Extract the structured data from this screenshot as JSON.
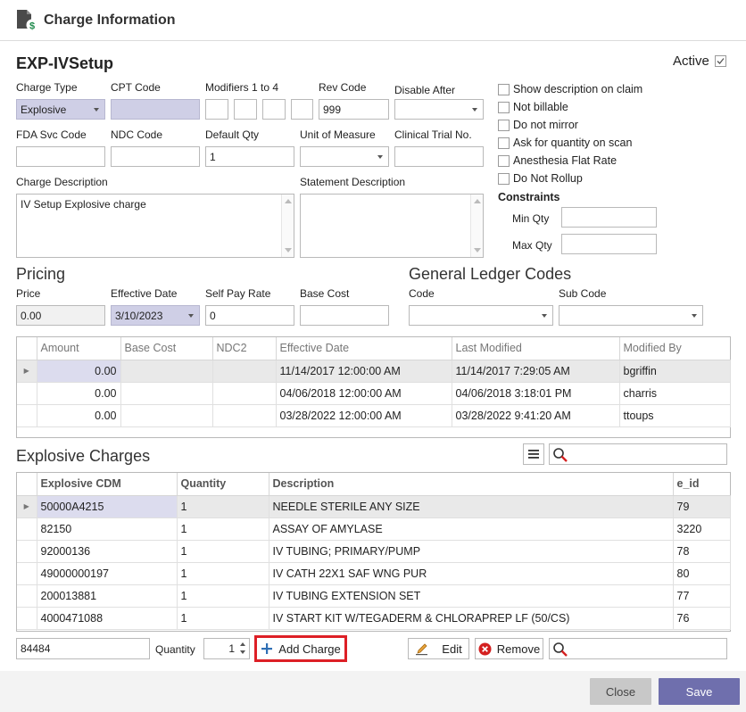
{
  "window": {
    "title": "Charge Information"
  },
  "charge": {
    "name": "EXP-IVSetup",
    "active_label": "Active",
    "active_checked": true
  },
  "fields": {
    "charge_type_label": "Charge Type",
    "charge_type_value": "Explosive",
    "cpt_code_label": "CPT Code",
    "cpt_code_value": "",
    "modifiers_label": "Modifiers 1 to 4",
    "rev_code_label": "Rev Code",
    "rev_code_value": "999",
    "disable_after_label": "Disable After",
    "disable_after_value": "",
    "fda_label": "FDA Svc Code",
    "fda_value": "",
    "ndc_label": "NDC Code",
    "ndc_value": "",
    "default_qty_label": "Default Qty",
    "default_qty_value": "1",
    "uom_label": "Unit of Measure",
    "uom_value": "",
    "trial_label": "Clinical Trial No.",
    "trial_value": "",
    "charge_desc_label": "Charge Description",
    "charge_desc_value": "IV Setup Explosive charge",
    "stmt_desc_label": "Statement Description",
    "stmt_desc_value": ""
  },
  "options": [
    {
      "label": "Show description on claim",
      "checked": false
    },
    {
      "label": "Not billable",
      "checked": false
    },
    {
      "label": "Do not mirror",
      "checked": false
    },
    {
      "label": "Ask for quantity on scan",
      "checked": false
    },
    {
      "label": "Anesthesia Flat Rate",
      "checked": false
    },
    {
      "label": "Do Not Rollup",
      "checked": false
    }
  ],
  "constraints": {
    "title": "Constraints",
    "min_label": "Min Qty",
    "min_value": "",
    "max_label": "Max Qty",
    "max_value": ""
  },
  "pricing": {
    "title": "Pricing",
    "price_label": "Price",
    "price_value": "0.00",
    "eff_label": "Effective Date",
    "eff_value": "3/10/2023",
    "self_pay_label": "Self Pay Rate",
    "self_pay_value": "0",
    "base_cost_label": "Base Cost",
    "base_cost_value": ""
  },
  "gl": {
    "title": "General Ledger Codes",
    "code_label": "Code",
    "code_value": "",
    "sub_label": "Sub Code",
    "sub_value": ""
  },
  "price_table": {
    "columns": [
      "Amount",
      "Base Cost",
      "NDC2",
      "Effective Date",
      "Last Modified",
      "Modified By"
    ],
    "rows": [
      [
        "0.00",
        "",
        "",
        "11/14/2017 12:00:00 AM",
        "11/14/2017 7:29:05 AM",
        "bgriffin"
      ],
      [
        "0.00",
        "",
        "",
        "04/06/2018 12:00:00 AM",
        "04/06/2018 3:18:01 PM",
        "charris"
      ],
      [
        "0.00",
        "",
        "",
        "03/28/2022 12:00:00 AM",
        "03/28/2022 9:41:20 AM",
        "ttoups"
      ]
    ]
  },
  "explosive": {
    "title": "Explosive Charges",
    "search_value": "",
    "columns": [
      "Explosive CDM",
      "Quantity",
      "Description",
      "e_id"
    ],
    "rows": [
      [
        "50000A4215",
        "1",
        "NEEDLE STERILE ANY SIZE",
        "79"
      ],
      [
        "82150",
        "1",
        "ASSAY OF AMYLASE",
        "3220"
      ],
      [
        "92000136",
        "1",
        "IV TUBING; PRIMARY/PUMP",
        "78"
      ],
      [
        "49000000197",
        "1",
        "IV CATH 22X1 SAF WNG PUR",
        "80"
      ],
      [
        "200013881",
        "1",
        "IV TUBING EXTENSION SET",
        "77"
      ],
      [
        "4000471088",
        "1",
        "IV START KIT W/TEGADERM & CHLORAPREP LF (50/CS)",
        "76"
      ]
    ]
  },
  "add_bar": {
    "code_value": "84484",
    "qty_label": "Quantity",
    "qty_value": "1",
    "add_label": "Add Charge",
    "edit_label": "Edit",
    "remove_label": "Remove",
    "search_value": ""
  },
  "footer": {
    "close_label": "Close",
    "save_label": "Save"
  },
  "colors": {
    "accent": "#6f6fad",
    "highlight": "#dd1f26",
    "close_bg": "#c8c8c8",
    "selected_cell": "#d8d8ee"
  }
}
